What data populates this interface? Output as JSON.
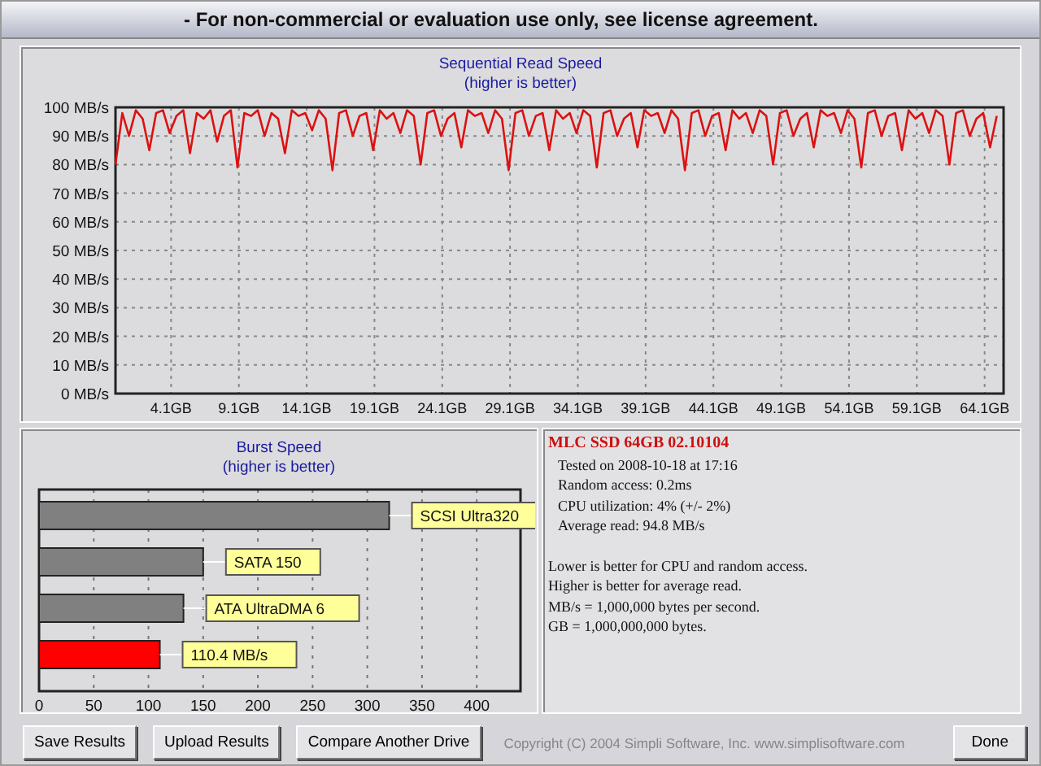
{
  "window": {
    "title": "- For non-commercial or evaluation use only, see license agreement."
  },
  "sequential_read": {
    "title": "Sequential Read Speed",
    "subtitle": "(higher is better)",
    "chart_data": {
      "type": "line",
      "xlim": [
        0,
        65.5
      ],
      "ylim": [
        0,
        100
      ],
      "grid": true,
      "yticks": [
        {
          "value": 100,
          "label": "100 MB/s"
        },
        {
          "value": 90,
          "label": "90 MB/s"
        },
        {
          "value": 80,
          "label": "80 MB/s"
        },
        {
          "value": 70,
          "label": "70 MB/s"
        },
        {
          "value": 60,
          "label": "60 MB/s"
        },
        {
          "value": 50,
          "label": "50 MB/s"
        },
        {
          "value": 40,
          "label": "40 MB/s"
        },
        {
          "value": 30,
          "label": "30 MB/s"
        },
        {
          "value": 20,
          "label": "20 MB/s"
        },
        {
          "value": 10,
          "label": "10 MB/s"
        },
        {
          "value": 0,
          "label": "0 MB/s"
        }
      ],
      "xticks": [
        {
          "value": 4.1,
          "label": "4.1GB"
        },
        {
          "value": 9.1,
          "label": "9.1GB"
        },
        {
          "value": 14.1,
          "label": "14.1GB"
        },
        {
          "value": 19.1,
          "label": "19.1GB"
        },
        {
          "value": 24.1,
          "label": "24.1GB"
        },
        {
          "value": 29.1,
          "label": "29.1GB"
        },
        {
          "value": 34.1,
          "label": "34.1GB"
        },
        {
          "value": 39.1,
          "label": "39.1GB"
        },
        {
          "value": 44.1,
          "label": "44.1GB"
        },
        {
          "value": 49.1,
          "label": "49.1GB"
        },
        {
          "value": 54.1,
          "label": "54.1GB"
        },
        {
          "value": 59.1,
          "label": "59.1GB"
        },
        {
          "value": 64.1,
          "label": "64.1GB"
        }
      ],
      "x": [
        0,
        0.5,
        1,
        1.5,
        2,
        2.5,
        3,
        3.5,
        4,
        4.5,
        5,
        5.5,
        6,
        6.5,
        7,
        7.5,
        8,
        8.5,
        9,
        9.5,
        10,
        10.5,
        11,
        11.5,
        12,
        12.5,
        13,
        13.5,
        14,
        14.5,
        15,
        15.5,
        16,
        16.5,
        17,
        17.5,
        18,
        18.5,
        19,
        19.5,
        20,
        20.5,
        21,
        21.5,
        22,
        22.5,
        23,
        23.5,
        24,
        24.5,
        25,
        25.5,
        26,
        26.5,
        27,
        27.5,
        28,
        28.5,
        29,
        29.5,
        30,
        30.5,
        31,
        31.5,
        32,
        32.5,
        33,
        33.5,
        34,
        34.5,
        35,
        35.5,
        36,
        36.5,
        37,
        37.5,
        38,
        38.5,
        39,
        39.5,
        40,
        40.5,
        41,
        41.5,
        42,
        42.5,
        43,
        43.5,
        44,
        44.5,
        45,
        45.5,
        46,
        46.5,
        47,
        47.5,
        48,
        48.5,
        49,
        49.5,
        50,
        50.5,
        51,
        51.5,
        52,
        52.5,
        53,
        53.5,
        54,
        54.5,
        55,
        55.5,
        56,
        56.5,
        57,
        57.5,
        58,
        58.5,
        59,
        59.5,
        60,
        60.5,
        61,
        61.5,
        62,
        62.5,
        63,
        63.5,
        64,
        64.5,
        65
      ],
      "series": [
        {
          "color": "#dd1111",
          "values": [
            80,
            98,
            90,
            99,
            96,
            85,
            98,
            99,
            91,
            97,
            99,
            84,
            98,
            96,
            99,
            88,
            97,
            99,
            79,
            98,
            97,
            99,
            90,
            98,
            96,
            84,
            99,
            97,
            98,
            92,
            99,
            96,
            78,
            98,
            99,
            90,
            97,
            98,
            85,
            99,
            96,
            98,
            91,
            99,
            97,
            80,
            98,
            99,
            90,
            96,
            98,
            86,
            99,
            97,
            98,
            91,
            99,
            96,
            78,
            98,
            99,
            90,
            97,
            98,
            85,
            99,
            96,
            98,
            91,
            99,
            97,
            79,
            98,
            99,
            90,
            96,
            98,
            86,
            99,
            97,
            98,
            91,
            99,
            96,
            78,
            98,
            99,
            90,
            97,
            98,
            85,
            99,
            96,
            98,
            91,
            99,
            97,
            80,
            98,
            99,
            90,
            96,
            98,
            86,
            99,
            97,
            98,
            91,
            99,
            96,
            79,
            98,
            99,
            90,
            97,
            98,
            85,
            99,
            96,
            98,
            91,
            99,
            97,
            80,
            98,
            99,
            90,
            96,
            98,
            86,
            97
          ]
        }
      ]
    }
  },
  "burst_speed": {
    "title": "Burst Speed",
    "subtitle": "(higher is better)",
    "chart_data": {
      "type": "bar",
      "orientation": "horizontal",
      "grid": true,
      "values": [
        320,
        150,
        132,
        110.4
      ],
      "colors": [
        "#808080",
        "#808080",
        "#808080",
        "#ff0000"
      ],
      "value_labels": [
        "SCSI Ultra320",
        "SATA 150",
        "ATA UltraDMA 6",
        "110.4 MB/s"
      ],
      "xlim": [
        0,
        440
      ],
      "xticks": [
        0,
        50,
        100,
        150,
        200,
        250,
        300,
        350,
        400
      ]
    }
  },
  "results": {
    "drive_name": "MLC SSD 64GB 02.10104",
    "details": [
      "Tested on 2008-10-18 at 17:16",
      "Random access: 0.2ms",
      "CPU utilization: 4% (+/- 2%)",
      "Average read: 94.8 MB/s"
    ],
    "notes": [
      "Lower is better for CPU and random access.",
      "Higher is better for average read.",
      "MB/s = 1,000,000 bytes per second.",
      "GB = 1,000,000,000 bytes."
    ]
  },
  "buttons": [
    "Save Results",
    "Upload Results",
    "Compare Another Drive"
  ],
  "copyright": "Copyright (C) 2004 Simpli Software, Inc. www.simplisoftware.com",
  "done_button": "Done"
}
